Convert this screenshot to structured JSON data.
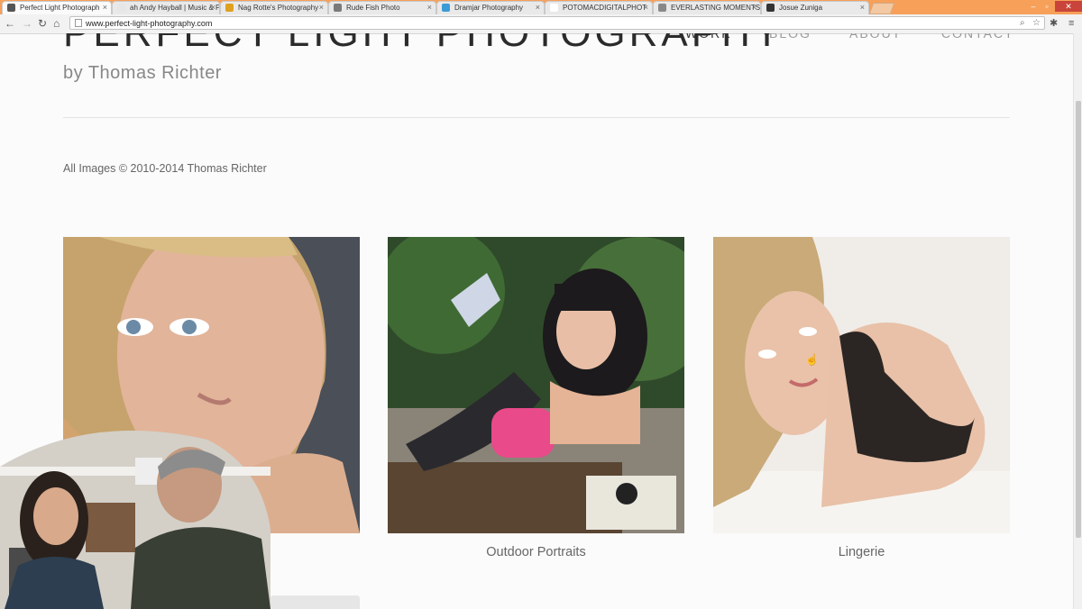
{
  "browser": {
    "tabs": [
      {
        "title": "Perfect Light Photograph",
        "active": true,
        "favicon_color": "#555555"
      },
      {
        "title": "ah Andy Hayball | Music & P",
        "active": false,
        "favicon_color": "#e6e6e6"
      },
      {
        "title": "Nag Rotte's Photography",
        "active": false,
        "favicon_color": "#e0a020"
      },
      {
        "title": "Rude Fish Photo",
        "active": false,
        "favicon_color": "#7a7a7a"
      },
      {
        "title": "Dramjar Photography",
        "active": false,
        "favicon_color": "#3c9ad6"
      },
      {
        "title": "POTOMACDIGITALPHOT",
        "active": false,
        "favicon_color": "#ffffff"
      },
      {
        "title": "EVERLASTING MOMENTS",
        "active": false,
        "favicon_color": "#888888"
      },
      {
        "title": "Josue Zuniga",
        "active": false,
        "favicon_color": "#333333"
      }
    ],
    "url": "www.perfect-light-photography.com"
  },
  "site": {
    "title": "PERFECT LIGHT PHOTOGRAPHY",
    "byline": "by Thomas Richter",
    "nav": [
      {
        "label": "WORK",
        "active": true
      },
      {
        "label": "BLOG",
        "active": false
      },
      {
        "label": "ABOUT",
        "active": false
      },
      {
        "label": "CONTACT",
        "active": false
      }
    ],
    "copyright": "All Images © 2010-2014 Thomas Richter"
  },
  "gallery": [
    {
      "caption": "",
      "icon": "portrait-photo"
    },
    {
      "caption": "Outdoor Portraits",
      "icon": "outdoor-photo"
    },
    {
      "caption": "Lingerie",
      "icon": "lingerie-photo"
    }
  ],
  "colors": {
    "tabstrip": "#f6a05a",
    "page_bg": "#fbfbfb",
    "title": "#2b2b2b"
  }
}
